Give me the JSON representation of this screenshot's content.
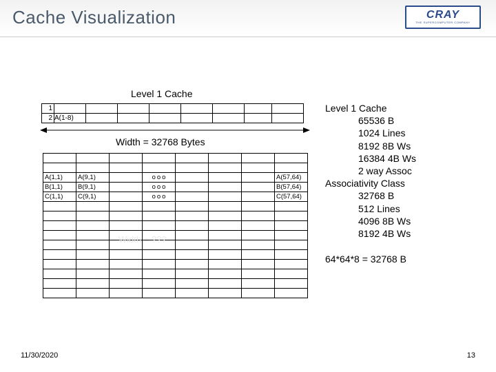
{
  "title": "Cache Visualization",
  "logo": {
    "main": "CRAY",
    "sub": "THE SUPERCOMPUTER COMPANY"
  },
  "diagram": {
    "heading": "Level 1 Cache",
    "row1_index": "1",
    "row2_index": "2",
    "row2_cell0": "A(1-8)",
    "width_label": "Width = 32768 Bytes",
    "cells": {
      "a11": "A(1,1)",
      "a91": "A(9,1)",
      "a5764": "A(57,64)",
      "b11": "B(1,1)",
      "b91": "B(9,1)",
      "b5764": "B(57,64)",
      "c11": "C(1,1)",
      "c91": "C(9,1)",
      "c5764": "C(57,64)",
      "dots": "ooo"
    },
    "hidden_w": "Width = ???"
  },
  "specs": {
    "head1": "Level 1 Cache",
    "l1": "65536 B",
    "l2": "1024 Lines",
    "l3": "8192 8B Ws",
    "l4": "16384 4B Ws",
    "l5": "2 way Assoc",
    "head2": "Associativity Class",
    "a1": "32768 B",
    "a2": "512 Lines",
    "a3": "4096 8B Ws",
    "a4": "8192 4B Ws"
  },
  "calc": "64*64*8 = 32768 B",
  "footer": {
    "date": "11/30/2020",
    "page": "13"
  }
}
